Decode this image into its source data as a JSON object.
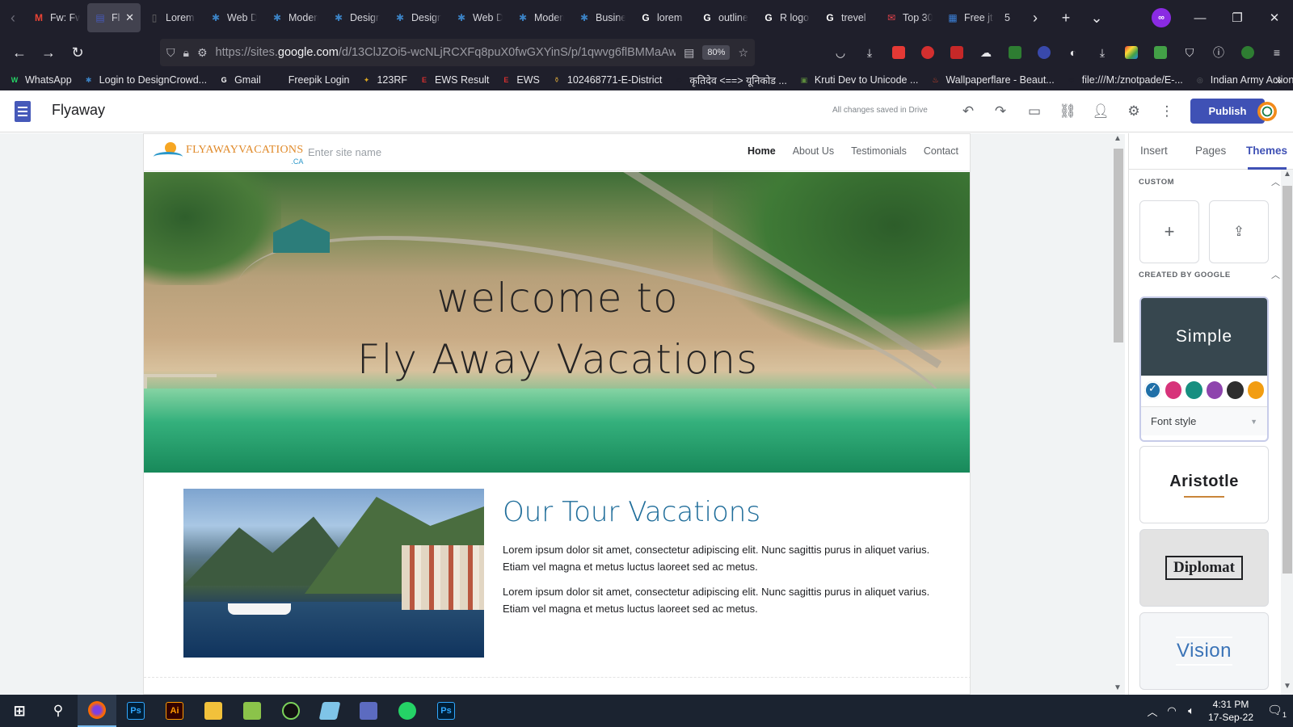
{
  "browser": {
    "tabs": [
      {
        "label": "Fw: Fw",
        "fav": "M",
        "fav_color": "#ea4335",
        "active": false
      },
      {
        "label": "Flyaway",
        "fav": "▤",
        "fav_color": "#4659b9",
        "active": true
      },
      {
        "label": "Lorem ipsum",
        "fav": "▯",
        "fav_color": "#6b6b6b",
        "active": false
      },
      {
        "label": "Web Design",
        "fav": "✱",
        "fav_color": "#3b82c4",
        "active": false
      },
      {
        "label": "Modern",
        "fav": "✱",
        "fav_color": "#3b82c4",
        "active": false
      },
      {
        "label": "Design",
        "fav": "✱",
        "fav_color": "#3b82c4",
        "active": false
      },
      {
        "label": "Design",
        "fav": "✱",
        "fav_color": "#3b82c4",
        "active": false
      },
      {
        "label": "Web Design",
        "fav": "✱",
        "fav_color": "#3b82c4",
        "active": false
      },
      {
        "label": "Modern",
        "fav": "✱",
        "fav_color": "#3b82c4",
        "active": false
      },
      {
        "label": "Business",
        "fav": "✱",
        "fav_color": "#3b82c4",
        "active": false
      },
      {
        "label": "lorem",
        "fav": "G",
        "fav_color": "#ffffff",
        "active": false
      },
      {
        "label": "outline",
        "fav": "G",
        "fav_color": "#ffffff",
        "active": false
      },
      {
        "label": "R logo",
        "fav": "G",
        "fav_color": "#ffffff",
        "active": false
      },
      {
        "label": "trevel",
        "fav": "G",
        "fav_color": "#ffffff",
        "active": false
      },
      {
        "label": "Top 30",
        "fav": "✉",
        "fav_color": "#e8434c",
        "active": false
      },
      {
        "label": "Free jt",
        "fav": "▦",
        "fav_color": "#3b7fd6",
        "active": false
      }
    ],
    "tab_overflow_label": "5",
    "url_prefix": "https://sites.",
    "url_domain": "google.com",
    "url_rest": "/d/13ClJZOi5-wcNLjRCXFq8puX0fwGXYinS/p/1qwvg6flBMMaAw",
    "zoom": "80%",
    "bookmarks": [
      {
        "label": "WhatsApp",
        "icon": "W",
        "color": "#25d366"
      },
      {
        "label": "Login to DesignCrowd...",
        "icon": "✱",
        "color": "#3b82c4"
      },
      {
        "label": "Gmail",
        "icon": "G",
        "color": "#ffffff"
      },
      {
        "label": "Freepik Login",
        "icon": "F",
        "color": "#1f1f2b"
      },
      {
        "label": "123RF",
        "icon": "✦",
        "color": "#d9a521"
      },
      {
        "label": "EWS Result",
        "icon": "E",
        "color": "#d32f2f"
      },
      {
        "label": "EWS",
        "icon": "E",
        "color": "#d32f2f"
      },
      {
        "label": "102468771-E-District",
        "icon": "⚱",
        "color": "#c79a3a"
      },
      {
        "label": "कृतिदेव <==> यूनिकोड ...",
        "icon": "⊕",
        "color": "#1f1f2b"
      },
      {
        "label": "Kruti Dev to Unicode ...",
        "icon": "▣",
        "color": "#5b8a3c"
      },
      {
        "label": "Wallpaperflare - Beaut...",
        "icon": "♨",
        "color": "#e5492b"
      },
      {
        "label": "file:///M:/znotpade/E-...",
        "icon": "⊕",
        "color": "#1f1f2b"
      },
      {
        "label": "Indian Army Action M...",
        "icon": "◎",
        "color": "#5f6368"
      }
    ]
  },
  "sites": {
    "title": "Flyaway",
    "saved_status": "All changes saved in Drive",
    "publish_label": "Publish"
  },
  "site_page": {
    "logo_text": "FLYAWAYVACATIONS",
    "logo_sub": ".CA",
    "site_name_placeholder": "Enter site name",
    "nav": [
      "Home",
      "About Us",
      "Testimonials",
      "Contact"
    ],
    "hero_line1": "welcome to",
    "hero_line2": "Fly Away Vacations",
    "section_title": "Our Tour Vacations",
    "para1": "Lorem ipsum dolor sit amet, consectetur adipiscing elit. Nunc sagittis purus in aliquet varius. Etiam vel magna et metus luctus laoreet sed ac metus.",
    "para2": "Lorem ipsum dolor sit amet, consectetur adipiscing elit. Nunc sagittis purus in aliquet varius. Etiam vel magna et metus luctus laoreet sed ac metus."
  },
  "panel": {
    "tabs": [
      "Insert",
      "Pages",
      "Themes"
    ],
    "active_tab": "Themes",
    "custom_heading": "CUSTOM",
    "google_heading": "CREATED BY GOOGLE",
    "theme_simple": "Simple",
    "swatch_colors": [
      "#1f6fa8",
      "#d7337a",
      "#178f80",
      "#8e44ad",
      "#2e2e2e",
      "#f29d12"
    ],
    "font_style_label": "Font style",
    "theme_aristotle": "Aristotle",
    "theme_diplomat": "Diplomat",
    "theme_vision": "Vision"
  },
  "taskbar": {
    "time": "4:31 PM",
    "date": "17-Sep-22",
    "notification_count": "1"
  }
}
